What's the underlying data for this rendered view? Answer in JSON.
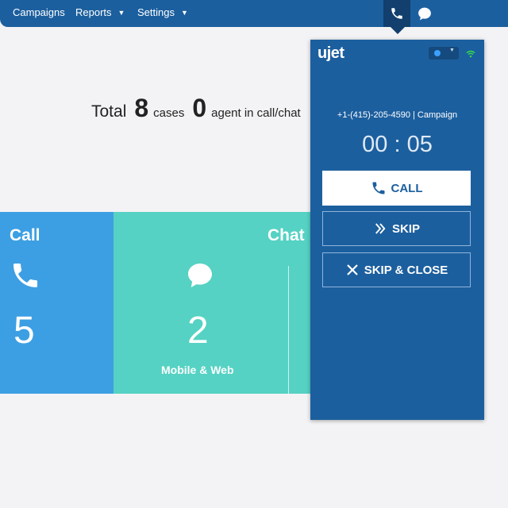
{
  "nav": {
    "campaigns": "Campaigns",
    "reports": "Reports",
    "settings": "Settings",
    "phone_icon": "phone-icon",
    "chat_icon": "chat-bubble-icon"
  },
  "summary": {
    "total_label": "Total",
    "cases_count": "8",
    "cases_label": "cases",
    "agent_count": "0",
    "agent_label": "agent in call/chat"
  },
  "cards": {
    "call": {
      "title": "Call",
      "count": "5",
      "icon": "phone-icon",
      "color": "#3d9fe3"
    },
    "chat": {
      "title": "Chat",
      "count": "2",
      "sub_label": "Mobile & Web",
      "icon": "chat-bubble-icon",
      "color": "#55d2c3"
    }
  },
  "widget": {
    "logo": "ujet",
    "status_color": "#3aa1ff",
    "caller_info": "+1-(415)-205-4590 | Campaign",
    "timer": "00 : 05",
    "call_button": "CALL",
    "skip_button": "SKIP",
    "skip_close_button": "SKIP & CLOSE",
    "background": "#1c5f9e"
  },
  "colors": {
    "topbar": "#1c5f9e",
    "page_bg": "#f3f3f5"
  }
}
